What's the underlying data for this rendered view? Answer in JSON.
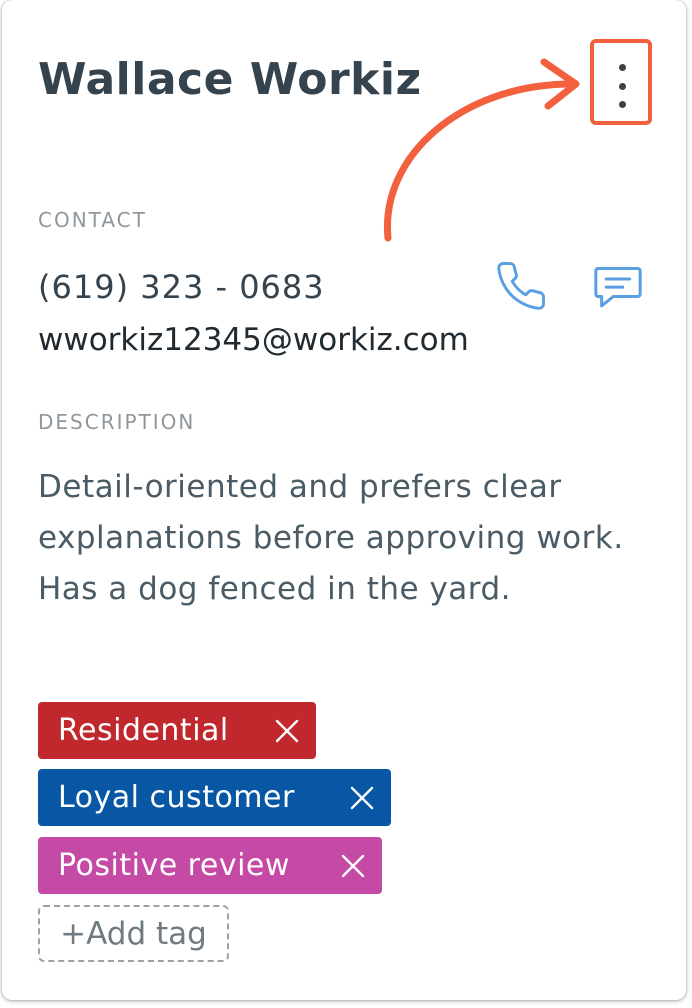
{
  "customer": {
    "name": "Wallace Workiz"
  },
  "contact": {
    "label": "CONTACT",
    "phone": "(619) 323 - 0683",
    "email": "wworkiz12345@workiz.com"
  },
  "description": {
    "label": "DESCRIPTION",
    "text": "Detail-oriented and prefers clear explanations before approving work. Has a dog fenced in the yard."
  },
  "tags": [
    {
      "label": "Residential",
      "color": "#c0282d"
    },
    {
      "label": "Loyal customer",
      "color": "#0857a5"
    },
    {
      "label": "Positive review",
      "color": "#c44aa6"
    }
  ],
  "add_tag_label": "+Add tag",
  "colors": {
    "highlight": "#f2603d",
    "icon_accent": "#5b9fe3",
    "heading_text": "#34434e",
    "label_text": "#8f979d"
  },
  "icons": {
    "menu": "kebab-menu-icon",
    "call": "phone-icon",
    "message": "chat-bubble-icon",
    "remove_tag": "close-icon",
    "callout": "curved-arrow-icon"
  }
}
